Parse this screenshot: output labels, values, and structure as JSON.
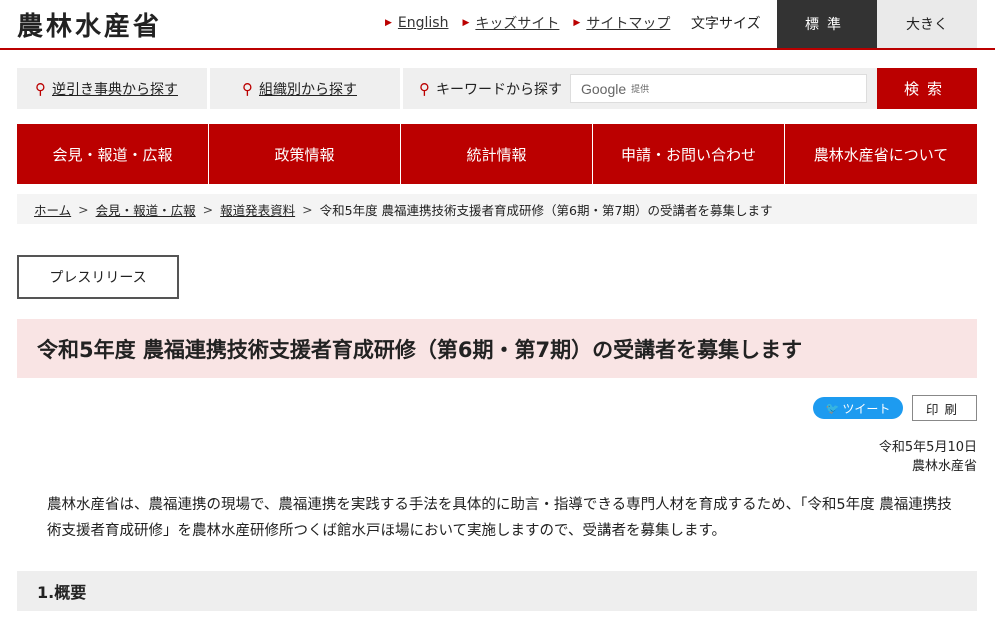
{
  "header": {
    "logo": "農林水産省",
    "links": [
      {
        "label": "English"
      },
      {
        "label": "キッズサイト"
      },
      {
        "label": "サイトマップ"
      }
    ],
    "font_size_label": "文字サイズ",
    "font_size_standard": "標準",
    "font_size_large": "大きく"
  },
  "search": {
    "reverse_lookup": "逆引き事典から探す",
    "by_organization": "組織別から探す",
    "keyword": "キーワードから探す",
    "google_label": "Google",
    "google_provided": "提供",
    "button": "検索"
  },
  "nav": [
    {
      "label": "会見・報道・広報"
    },
    {
      "label": "政策情報"
    },
    {
      "label": "統計情報"
    },
    {
      "label": "申請・お問い合わせ"
    },
    {
      "label": "農林水産省について"
    }
  ],
  "breadcrumb": {
    "items": [
      "ホーム",
      "会見・報道・広報",
      "報道発表資料"
    ],
    "current": "令和5年度 農福連携技術支援者育成研修（第6期・第7期）の受講者を募集します"
  },
  "category": "プレスリリース",
  "title": "令和5年度 農福連携技術支援者育成研修（第6期・第7期）の受講者を募集します",
  "share": {
    "tweet": "ツイート",
    "print": "印刷"
  },
  "date": "令和5年5月10日",
  "organization": "農林水産省",
  "lead": "農林水産省は、農福連携の現場で、農福連携を実践する手法を具体的に助言・指導できる専門人材を育成するため、「令和5年度 農福連携技術支援者育成研修」を農林水産研修所つくば館水戸ほ場において実施しますので、受講者を募集します。",
  "section_heading": "1.概要",
  "colors": {
    "brand_red": "#bb0000",
    "title_bg": "#f9e4e4",
    "twitter_blue": "#1d9bf0"
  }
}
